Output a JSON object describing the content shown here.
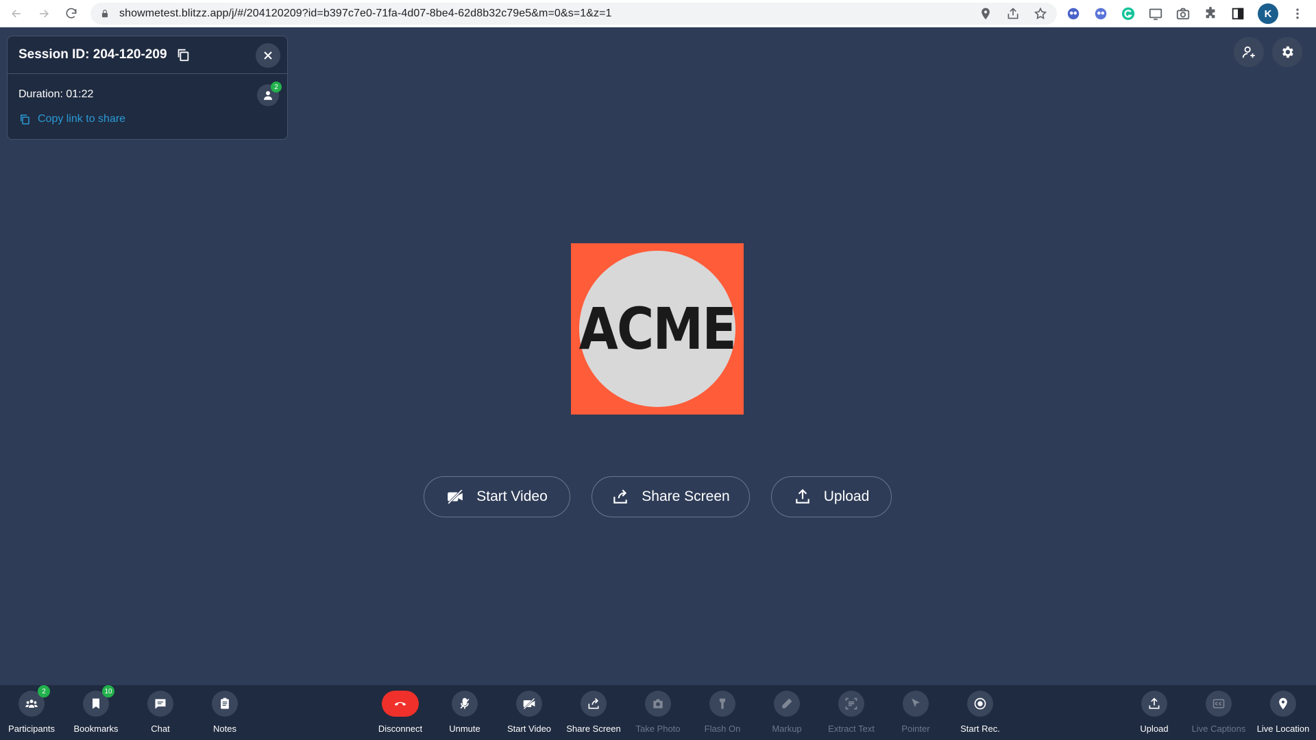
{
  "browser": {
    "url": "showmetest.blitzz.app/j/#/204120209?id=b397c7e0-71fa-4d07-8be4-62d8b32c79e5&m=0&s=1&z=1",
    "profile_initial": "K"
  },
  "session": {
    "title": "Session ID: 204-120-209",
    "duration": "Duration: 01:22",
    "participant_count": "2",
    "copy_link": "Copy link to share"
  },
  "logo": {
    "text": "ACME",
    "bg_color": "#ff5c3a",
    "circle_color": "#d8d8d8"
  },
  "actions": {
    "start_video": "Start Video",
    "share_screen": "Share Screen",
    "upload": "Upload"
  },
  "toolbar": {
    "participants": {
      "label": "Participants",
      "badge": "2"
    },
    "bookmarks": {
      "label": "Bookmarks",
      "badge": "10"
    },
    "chat": {
      "label": "Chat"
    },
    "notes": {
      "label": "Notes"
    },
    "disconnect": {
      "label": "Disconnect"
    },
    "unmute": {
      "label": "Unmute"
    },
    "start_video": {
      "label": "Start Video"
    },
    "share_screen": {
      "label": "Share Screen"
    },
    "take_photo": {
      "label": "Take Photo"
    },
    "flash_on": {
      "label": "Flash On"
    },
    "markup": {
      "label": "Markup"
    },
    "extract_text": {
      "label": "Extract Text"
    },
    "pointer": {
      "label": "Pointer"
    },
    "start_rec": {
      "label": "Start Rec."
    },
    "upload": {
      "label": "Upload"
    },
    "live_captions": {
      "label": "Live Captions"
    },
    "live_location": {
      "label": "Live Location"
    }
  },
  "colors": {
    "background": "#2e3c57",
    "panel": "#1f2b40",
    "accent_link": "#2a9ad6",
    "badge": "#22b14c",
    "disconnect": "#f0302a"
  }
}
